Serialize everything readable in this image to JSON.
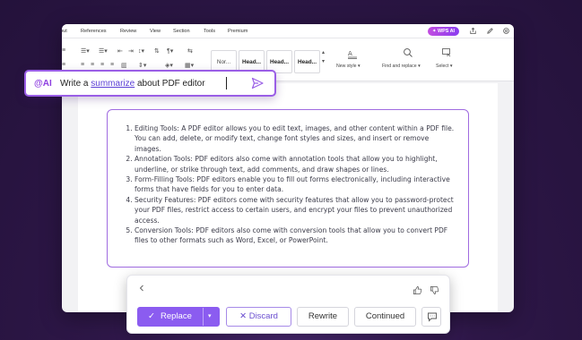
{
  "menubar": {
    "items": [
      "out",
      "References",
      "Review",
      "View",
      "Section",
      "Tools",
      "Premium"
    ],
    "wps_ai_label": "WPS AI"
  },
  "ribbon": {
    "styles": [
      "Nor...",
      "Head...",
      "Head...",
      "Head..."
    ],
    "new_style_label": "New style",
    "find_replace_label": "Find and replace",
    "select_label": "Select"
  },
  "ai_input": {
    "tag": "@AI",
    "prompt_before": "Write a ",
    "prompt_keyword": "summarize",
    "prompt_after": " about PDF editor"
  },
  "generated_list": [
    "Editing Tools: A PDF editor allows you to edit text, images, and other content within a PDF file. You can add, delete, or modify text, change font styles and sizes, and insert or remove images.",
    "Annotation Tools: PDF editors also come with annotation tools that allow you to highlight, underline, or strike through text, add comments, and draw shapes or lines.",
    "Form-Filling Tools: PDF editors enable you to fill out forms electronically, including interactive forms that have fields for you to enter data.",
    "Security Features: PDF editors come with security features that allow you to password-protect your PDF files, restrict access to certain users, and encrypt your files to prevent unauthorized access.",
    "Conversion Tools: PDF editors also come with conversion tools that allow you to convert PDF files to other formats such as Word, Excel, or PowerPoint."
  ],
  "actions": {
    "replace_label": "Replace",
    "discard_label": "Discard",
    "rewrite_label": "Rewrite",
    "continued_label": "Continued"
  },
  "colors": {
    "accent": "#8b5cf0",
    "ai_tag": "#8e3fe0",
    "background": "#2e1748"
  }
}
